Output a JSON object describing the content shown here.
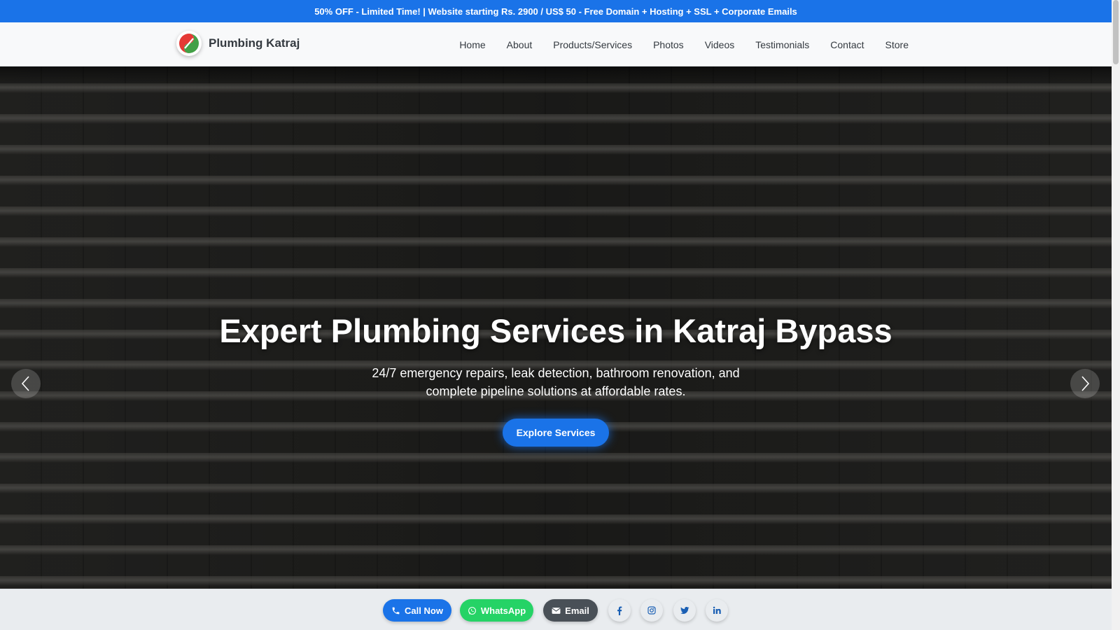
{
  "promo": {
    "text": "50% OFF - Limited Time! | Website starting Rs. 2900 / US$ 50 - Free Domain + Hosting + SSL + Corporate Emails"
  },
  "header": {
    "brand_name": "Plumbing Katraj",
    "logo_icon": "red-green-swirl-logo",
    "nav": [
      "Home",
      "About",
      "Products/Services",
      "Photos",
      "Videos",
      "Testimonials",
      "Contact",
      "Store"
    ]
  },
  "hero": {
    "title": "Expert Plumbing Services in Katraj Bypass",
    "subtitle": "24/7 emergency repairs, leak detection, bathroom renovation, and complete pipeline solutions at affordable rates.",
    "cta_label": "Explore Services",
    "prev_icon": "chevron-left-icon",
    "next_icon": "chevron-right-icon"
  },
  "bottom_bar": {
    "call_label": "Call Now",
    "whatsapp_label": "WhatsApp",
    "email_label": "Email",
    "social_icons": [
      "facebook-icon",
      "instagram-icon",
      "twitter-icon",
      "linkedin-icon"
    ]
  },
  "colors": {
    "accent": "#1a73e8",
    "whatsapp": "#25d366",
    "email": "#495057",
    "social_icon": "#1a5fb4"
  }
}
